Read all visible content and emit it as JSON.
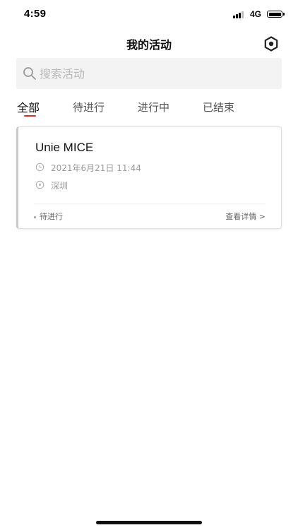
{
  "status_bar": {
    "time": "4:59",
    "network": "4G"
  },
  "header": {
    "title": "我的活动",
    "settings_icon": "gear-icon"
  },
  "search": {
    "placeholder": "搜索活动",
    "value": ""
  },
  "tabs": [
    {
      "label": "全部",
      "active": true
    },
    {
      "label": "待进行",
      "active": false
    },
    {
      "label": "进行中",
      "active": false
    },
    {
      "label": "已结束",
      "active": false
    }
  ],
  "activities": [
    {
      "title": "Unie MICE",
      "datetime": "2021年6月21日 11:44",
      "location": "深圳",
      "status": "待进行",
      "detail_label": "查看详情 >"
    }
  ],
  "colors": {
    "accent": "#d0312d",
    "search_bg": "#f3f3f3",
    "muted_text": "#9a9a9a"
  }
}
